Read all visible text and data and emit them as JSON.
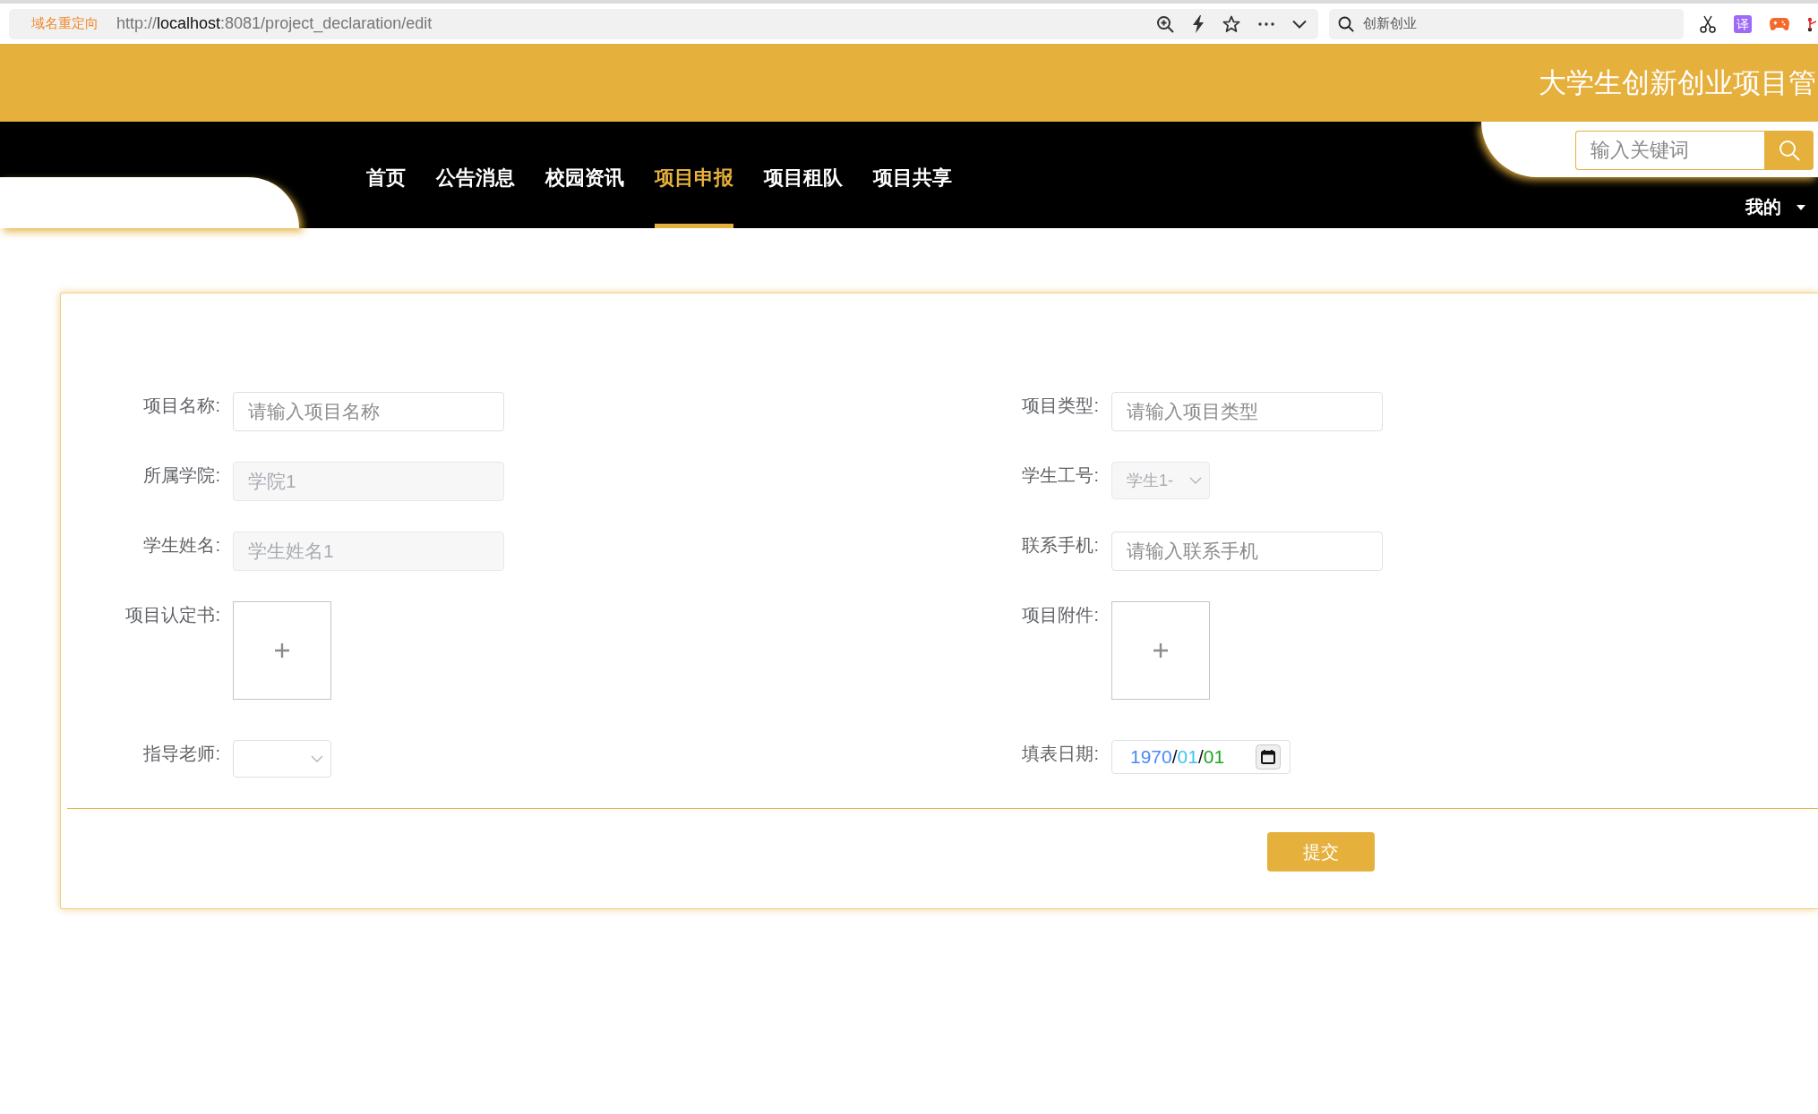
{
  "browser": {
    "redirect_label": "域名重定向",
    "url_scheme": "http://",
    "url_host": "localhost",
    "url_path": ":8081/project_declaration/edit",
    "search_placeholder": "创新创业",
    "translate_badge": "译"
  },
  "header": {
    "title": "大学生创新创业项目管"
  },
  "nav": {
    "items": [
      {
        "label": "首页",
        "selected": false
      },
      {
        "label": "公告消息",
        "selected": false
      },
      {
        "label": "校园资讯",
        "selected": false
      },
      {
        "label": "项目申报",
        "selected": true
      },
      {
        "label": "项目租队",
        "selected": false
      },
      {
        "label": "项目共享",
        "selected": false
      }
    ],
    "search_placeholder": "输入关键词",
    "user_menu": "我的"
  },
  "form": {
    "fields": [
      {
        "kind": "text",
        "label": "项目名称:",
        "placeholder": "请输入项目名称",
        "disabled": false
      },
      {
        "kind": "text",
        "label": "项目类型:",
        "placeholder": "请输入项目类型",
        "disabled": false
      },
      {
        "kind": "text",
        "label": "所属学院:",
        "value": "学院1",
        "disabled": true
      },
      {
        "kind": "select",
        "label": "学生工号:",
        "value": "学生1-",
        "disabled": true
      },
      {
        "kind": "text",
        "label": "学生姓名:",
        "value": "学生姓名1",
        "disabled": true
      },
      {
        "kind": "text",
        "label": "联系手机:",
        "placeholder": "请输入联系手机",
        "disabled": false
      },
      {
        "kind": "upload",
        "label": "项目认定书:"
      },
      {
        "kind": "upload",
        "label": "项目附件:"
      },
      {
        "kind": "select",
        "label": "指导老师:",
        "disabled": false
      },
      {
        "kind": "date",
        "label": "填表日期:",
        "value_parts": [
          {
            "text": "1970",
            "color": "#4a8af4"
          },
          {
            "text": "/",
            "color": "#111111"
          },
          {
            "text": "01",
            "color": "#3fc3f0"
          },
          {
            "text": "/",
            "color": "#111111"
          },
          {
            "text": "01",
            "color": "#1ba41b"
          }
        ]
      }
    ],
    "submit": "提交"
  }
}
